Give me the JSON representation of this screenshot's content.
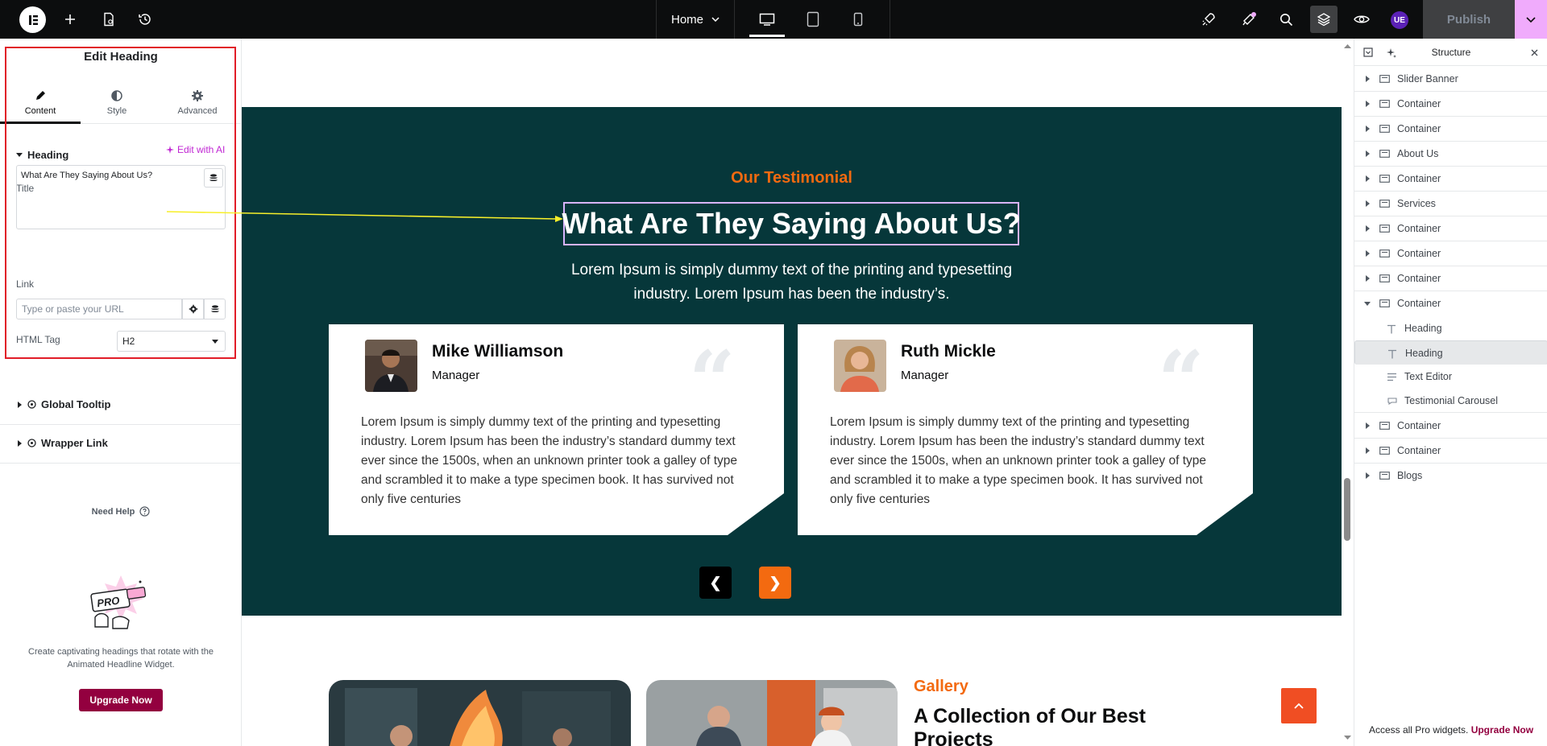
{
  "topbar": {
    "home_label": "Home",
    "publish_label": "Publish",
    "user_initials": "UE"
  },
  "panel": {
    "title": "Edit Heading",
    "tabs": [
      {
        "label": "Content"
      },
      {
        "label": "Style"
      },
      {
        "label": "Advanced"
      }
    ],
    "section": "Heading",
    "title_label": "Title",
    "edit_ai": "Edit with AI",
    "title_value": "What Are They Saying About Us?",
    "link_label": "Link",
    "link_placeholder": "Type or paste your URL",
    "tag_label": "HTML Tag",
    "tag_value": "H2",
    "global_tooltip": "Global Tooltip",
    "wrapper_link": "Wrapper Link",
    "need_help": "Need Help",
    "promo_text": "Create captivating headings that rotate with the Animated Headline Widget.",
    "upgrade_label": "Upgrade Now",
    "promo_badge": "PRO"
  },
  "canvas": {
    "eyebrow": "Our Testimonial",
    "heading": "What Are They Saying About Us?",
    "subtext": "Lorem Ipsum is simply dummy text of the printing and typesetting industry. Lorem Ipsum has been the industry’s.",
    "cards": [
      {
        "name": "Mike Williamson",
        "role": "Manager",
        "text": "Lorem Ipsum is simply dummy text of the printing and typesetting industry. Lorem Ipsum has been the industry’s standard dummy text ever since the 1500s, when an unknown printer took a galley of type and scrambled it to make a type specimen book. It has survived not only five centuries"
      },
      {
        "name": "Ruth Mickle",
        "role": "Manager",
        "text": "Lorem Ipsum is simply dummy text of the printing and typesetting industry. Lorem Ipsum has been the industry’s standard dummy text ever since the 1500s, when an unknown printer took a galley of type and scrambled it to make a type specimen book. It has survived not only five centuries"
      }
    ],
    "prev_label": "❮",
    "next_label": "❯",
    "gallery_eyebrow": "Gallery",
    "gallery_title": "A Collection of Our Best Projects"
  },
  "structure": {
    "title": "Structure",
    "items": [
      {
        "label": "Slider Banner"
      },
      {
        "label": "Container"
      },
      {
        "label": "Container"
      },
      {
        "label": "About Us"
      },
      {
        "label": "Container"
      },
      {
        "label": "Services"
      },
      {
        "label": "Container"
      },
      {
        "label": "Container"
      },
      {
        "label": "Container"
      },
      {
        "label": "Container"
      },
      {
        "label": "Heading"
      },
      {
        "label": "Heading"
      },
      {
        "label": "Text Editor"
      },
      {
        "label": "Testimonial Carousel"
      },
      {
        "label": "Container"
      },
      {
        "label": "Container"
      },
      {
        "label": "Blogs"
      }
    ],
    "footer_text": "Access all Pro widgets.",
    "footer_link": "Upgrade Now"
  },
  "colors": {
    "accent_orange": "#f36a10",
    "dark_teal": "#06373a",
    "pro_magenta": "#93003f",
    "ai_pink": "#c026d3"
  }
}
